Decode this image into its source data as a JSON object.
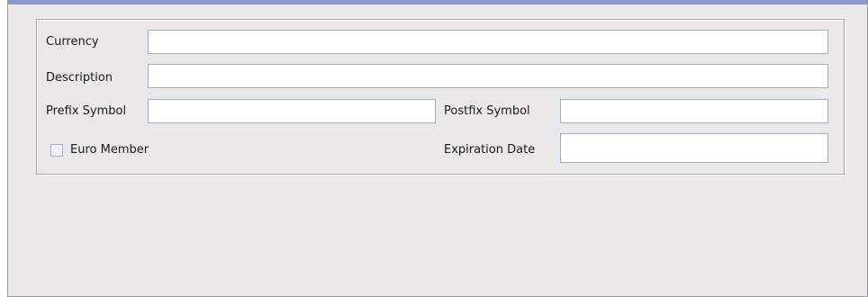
{
  "form": {
    "currency_label": "Currency",
    "currency_value": "",
    "description_label": "Description",
    "description_value": "",
    "prefix_symbol_label": "Prefix Symbol",
    "prefix_symbol_value": "",
    "postfix_symbol_label": "Postfix Symbol",
    "postfix_symbol_value": "",
    "euro_member_label": "Euro Member",
    "euro_member_checked": false,
    "expiration_date_label": "Expiration Date",
    "expiration_date_value": ""
  },
  "colors": {
    "accent_bar": "#8e97c8",
    "panel_bg": "#ebe8ea",
    "field_border": "#a3aac8"
  }
}
